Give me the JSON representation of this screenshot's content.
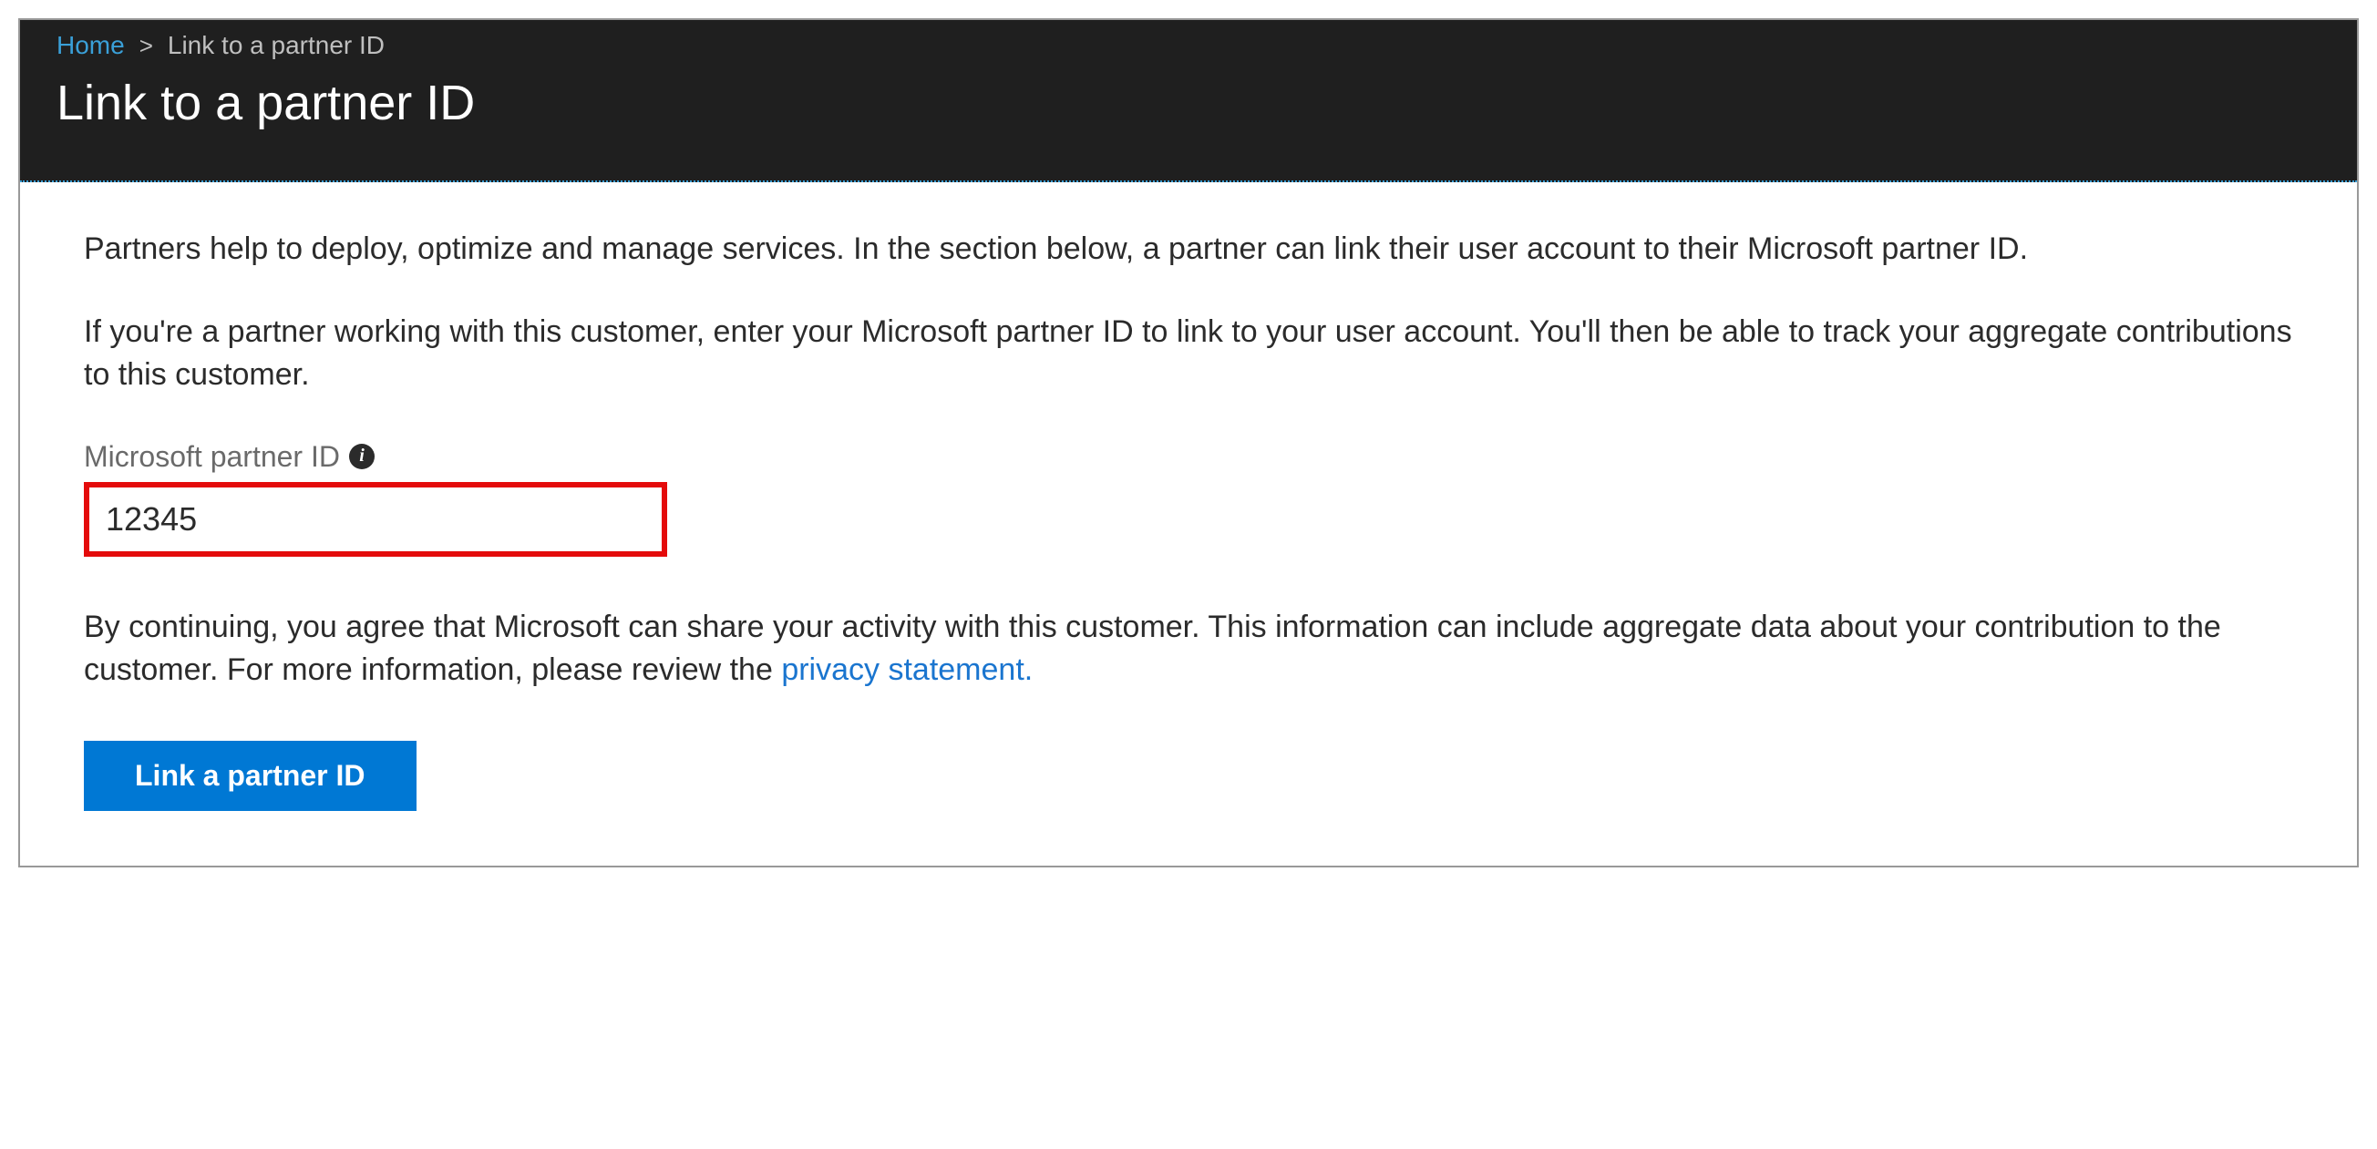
{
  "breadcrumb": {
    "home": "Home",
    "separator": ">",
    "current": "Link to a partner ID"
  },
  "page_title": "Link to a partner ID",
  "content": {
    "intro_para": "Partners help to deploy, optimize and manage services. In the section below, a partner can link their user account to their Microsoft partner ID.",
    "instruction_para": "If you're a partner working with this customer, enter your Microsoft partner ID to link to your user account. You'll then be able to track your aggregate contributions to this customer.",
    "field_label": "Microsoft partner ID",
    "field_value": "12345",
    "disclaimer_text": "By continuing, you agree that Microsoft can share your activity with this customer. This information can include aggregate data about your contribution to the customer. For more information, please review the ",
    "privacy_link_text": "privacy statement.",
    "button_label": "Link a partner ID"
  },
  "colors": {
    "accent": "#0078d4",
    "link": "#1a75cf",
    "header_bg": "#1f1f1f",
    "highlight_border": "#e40b0b"
  }
}
